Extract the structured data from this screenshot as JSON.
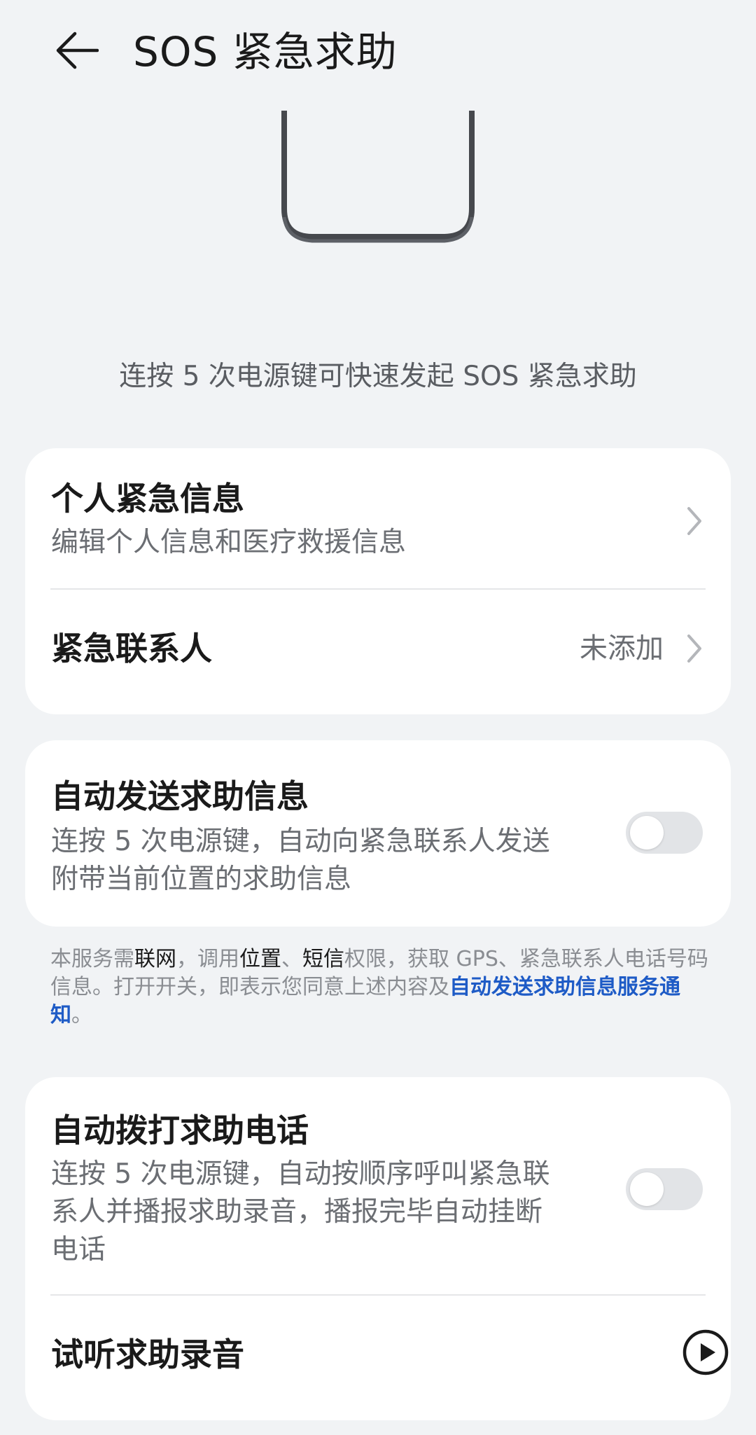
{
  "header": {
    "title": "SOS 紧急求助",
    "back_icon": "arrow-left-icon"
  },
  "illustration": {
    "icon": "phone-illustration"
  },
  "tip": "连按 5 次电源键可快速发起 SOS 紧急求助",
  "card1": {
    "personal_info": {
      "title": "个人紧急信息",
      "subtitle": "编辑个人信息和医疗救援信息"
    },
    "contacts": {
      "title": "紧急联系人",
      "value": "未添加"
    }
  },
  "card2": {
    "auto_message": {
      "title": "自动发送求助信息",
      "subtitle_line1": "连按 5 次电源键，自动向紧急联系人发送",
      "subtitle_line2": "附带当前位置的求助信息",
      "enabled": false
    }
  },
  "notice": {
    "p1": "本服务需",
    "b1": "联网",
    "p2": "，调用",
    "b2": "位置",
    "p3": "、",
    "b3": "短信",
    "p4": "权限，获取 GPS、紧急联系人电话号码信息。打开开关，即表示您同意上述内容及",
    "link": "自动发送求助信息服务通知",
    "p5": "。"
  },
  "card3": {
    "auto_call": {
      "title": "自动拨打求助电话",
      "subtitle_line1": "连按 5 次电源键，自动按顺序呼叫紧急联",
      "subtitle_line2": "系人并播报求助录音，播报完毕自动挂断",
      "subtitle_line3": "电话",
      "enabled": false
    },
    "preview": {
      "title": "试听求助录音",
      "icon": "play-circle-icon"
    }
  },
  "colors": {
    "background": "#f1f3f5",
    "card": "#ffffff",
    "link": "#1e5bc6",
    "toggle_off": "#e2e4e7"
  }
}
